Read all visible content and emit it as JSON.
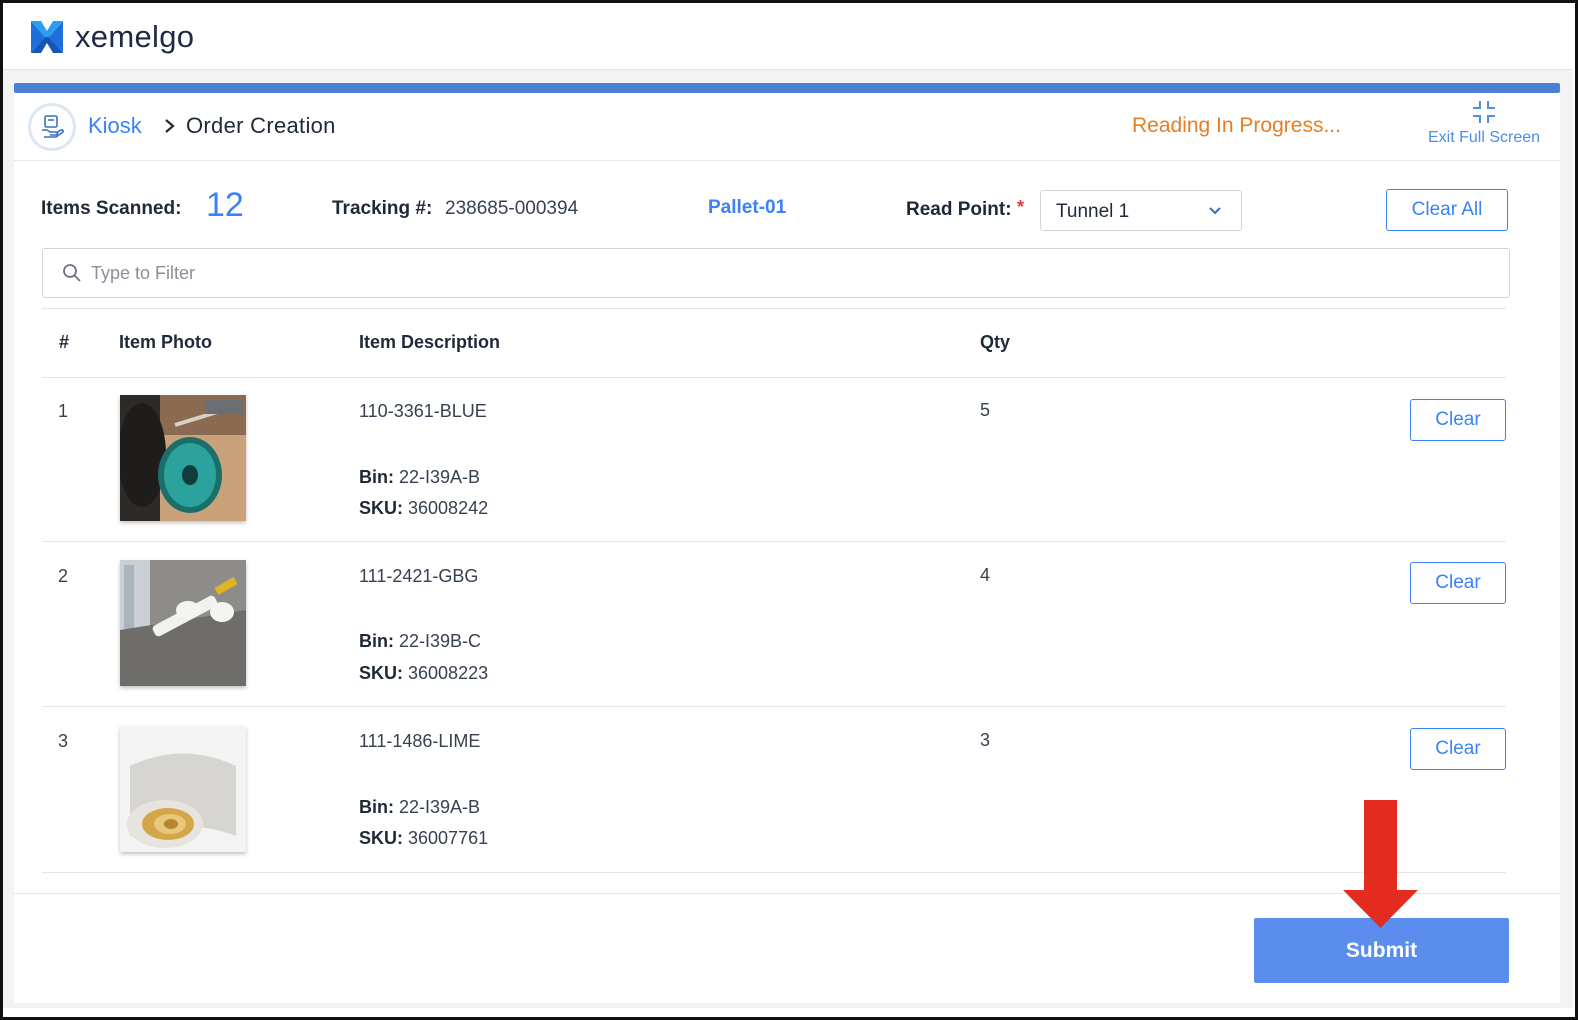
{
  "app": {
    "logo_text": "xemelgo"
  },
  "breadcrumb": {
    "parent": "Kiosk",
    "current": "Order Creation"
  },
  "status": {
    "text": "Reading In Progress...",
    "color": "#e67e22"
  },
  "exit_full_screen": {
    "label": "Exit Full Screen",
    "icon": "collapse-icon"
  },
  "info": {
    "items_scanned_label": "Items Scanned:",
    "items_scanned_value": "12",
    "tracking_label": "Tracking #:",
    "tracking_value": "238685-000394",
    "pallet": "Pallet-01",
    "read_point_label": "Read Point:",
    "required_mark": "*",
    "read_point_value": "Tunnel 1",
    "clear_all_label": "Clear All"
  },
  "filter": {
    "placeholder": "Type to Filter"
  },
  "table": {
    "headers": {
      "num": "#",
      "photo": "Item Photo",
      "description": "Item Description",
      "qty": "Qty"
    },
    "rows": [
      {
        "num": "1",
        "description": "110-3361-BLUE",
        "bin_label": "Bin:",
        "bin": "22-I39A-B",
        "sku_label": "SKU:",
        "sku": "36008242",
        "qty": "5",
        "clear_label": "Clear",
        "photo": "fishing-line-spool"
      },
      {
        "num": "2",
        "description": "111-2421-GBG",
        "bin_label": "Bin:",
        "bin": "22-I39B-C",
        "sku_label": "SKU:",
        "sku": "36008223",
        "qty": "4",
        "clear_label": "Clear",
        "photo": "caulk-gun"
      },
      {
        "num": "3",
        "description": "111-1486-LIME",
        "bin_label": "Bin:",
        "bin": "22-I39A-B",
        "sku_label": "SKU:",
        "sku": "36007761",
        "qty": "3",
        "clear_label": "Clear",
        "photo": "sandpaper-roll"
      }
    ]
  },
  "submit_label": "Submit",
  "colors": {
    "accent": "#3b82f6",
    "bar": "#4a7fd4",
    "submit": "#5b8def",
    "arrow": "#e32b1f"
  }
}
